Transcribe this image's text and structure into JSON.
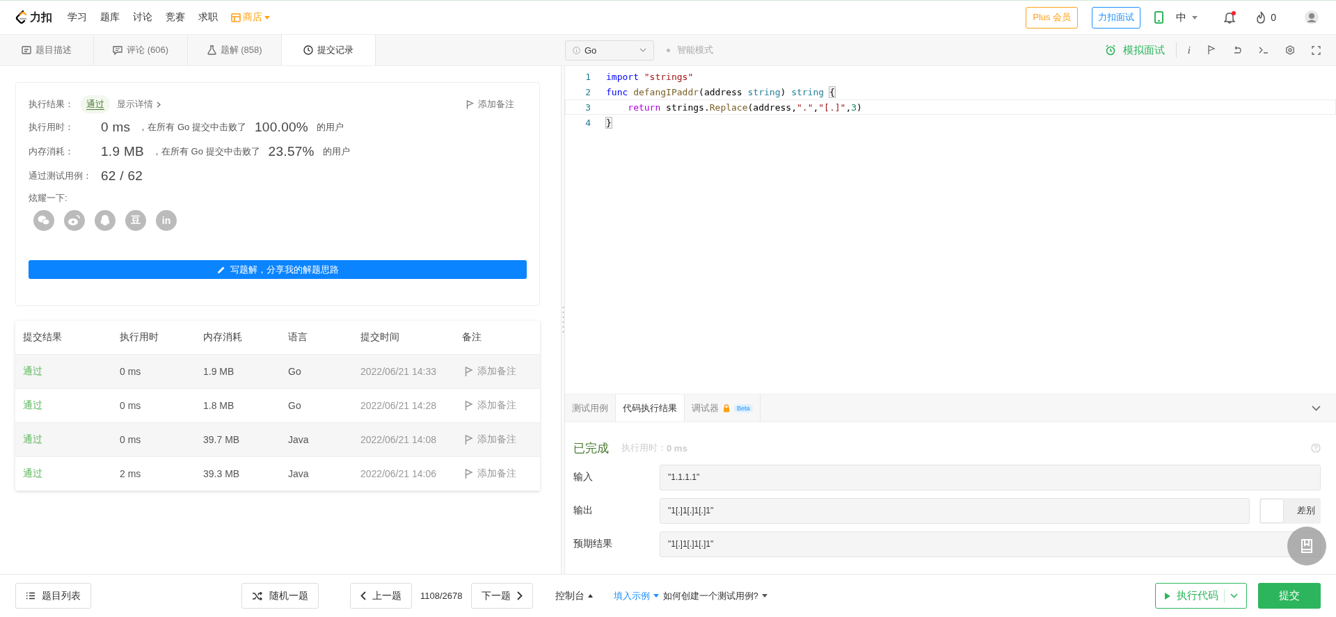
{
  "nav": {
    "logo": "力扣",
    "links": [
      {
        "label": "学习"
      },
      {
        "label": "题库"
      },
      {
        "label": "讨论"
      },
      {
        "label": "竞赛"
      },
      {
        "label": "求职"
      }
    ],
    "store": "商店",
    "plus": "Plus 会员",
    "interview": "力扣面试",
    "lang": "中",
    "unread": true,
    "fire_count": "0"
  },
  "left_tabs": [
    {
      "label": "题目描述",
      "selected": false
    },
    {
      "label": "评论 (606)",
      "selected": false
    },
    {
      "label": "题解 (858)",
      "selected": false
    },
    {
      "label": "提交记录",
      "selected": true
    }
  ],
  "result": {
    "result_label": "执行结果：",
    "status": "通过",
    "details": "显示详情",
    "add_note": "添加备注",
    "stats": [
      {
        "label": "执行用时：",
        "value": "0 ms",
        "text": "，在所有 Go 提交中击败了",
        "percent": "100.00%",
        "suffix": "的用户"
      },
      {
        "label": "内存消耗：",
        "value": "1.9 MB",
        "text": "，在所有 Go 提交中击败了",
        "percent": "23.57%",
        "suffix": "的用户"
      }
    ],
    "cases_label": "通过测试用例：",
    "cases": "62 / 62",
    "share_label": "炫耀一下:",
    "share": [
      {
        "kind": "wechat"
      },
      {
        "kind": "weibo"
      },
      {
        "kind": "qq"
      },
      {
        "kind": "glyph",
        "glyph": "豆"
      },
      {
        "kind": "glyph",
        "glyph": "in"
      }
    ],
    "write_button": "写题解，分享我的解题思路"
  },
  "table": {
    "columns": [
      "提交结果",
      "执行用时",
      "内存消耗",
      "语言",
      "提交时间",
      "备注"
    ],
    "rows": [
      {
        "status": "通过",
        "time": "0 ms",
        "memory": "1.9 MB",
        "language": "Go",
        "submitted": "2022/06/21 14:33",
        "note": "添加备注"
      },
      {
        "status": "通过",
        "time": "0 ms",
        "memory": "1.8 MB",
        "language": "Go",
        "submitted": "2022/06/21 14:28",
        "note": "添加备注"
      },
      {
        "status": "通过",
        "time": "0 ms",
        "memory": "39.7 MB",
        "language": "Java",
        "submitted": "2022/06/21 14:08",
        "note": "添加备注"
      },
      {
        "status": "通过",
        "time": "2 ms",
        "memory": "39.3 MB",
        "language": "Java",
        "submitted": "2022/06/21 14:06",
        "note": "添加备注"
      }
    ]
  },
  "editor_toolbar": {
    "language": "Go",
    "mode": "智能模式",
    "mock": "模拟面试",
    "info": "i"
  },
  "code": [
    {
      "number": "1",
      "tokens": [
        {
          "kind": "keyword",
          "text": "import"
        },
        {
          "kind": "string",
          "text": " \"strings\""
        }
      ]
    },
    {
      "number": "2",
      "tokens": [
        {
          "kind": "keyword",
          "text": "func"
        },
        {
          "kind": "function",
          "text": " defangIPaddr"
        },
        {
          "kind": "plain",
          "text": "(address "
        },
        {
          "kind": "type",
          "text": "string"
        },
        {
          "kind": "plain",
          "text": ") "
        },
        {
          "kind": "type",
          "text": "string "
        },
        {
          "kind": "bracket",
          "text": "{"
        }
      ]
    },
    {
      "number": "3",
      "current": true,
      "tokens": [
        {
          "kind": "control",
          "text": "    return"
        },
        {
          "kind": "plain",
          "text": " strings."
        },
        {
          "kind": "function",
          "text": "Replace"
        },
        {
          "kind": "plain",
          "text": "(address,"
        },
        {
          "kind": "string",
          "text": "\".\""
        },
        {
          "kind": "plain",
          "text": ","
        },
        {
          "kind": "string",
          "text": "\"[.]\""
        },
        {
          "kind": "plain",
          "text": ","
        },
        {
          "kind": "number",
          "text": "3"
        },
        {
          "kind": "plain",
          "text": ")"
        }
      ]
    },
    {
      "number": "4",
      "tokens": [
        {
          "kind": "bracket",
          "text": "}"
        }
      ]
    }
  ],
  "console_tabs": [
    {
      "label": "测试用例",
      "selected": false
    },
    {
      "label": "代码执行结果",
      "selected": true
    },
    {
      "label": "调试器",
      "locked": true,
      "badge": "Beta",
      "selected": false
    }
  ],
  "run_result": {
    "status": "已完成",
    "time_label": "执行用时：",
    "time": "0 ms",
    "fields": [
      {
        "label": "输入",
        "value": "\"1.1.1.1\""
      },
      {
        "label": "输出",
        "value": "\"1[.]1[.]1[.]1\"",
        "toggle": {
          "label": "差别",
          "on": false
        }
      },
      {
        "label": "预期结果",
        "value": "\"1[.]1[.]1[.]1\""
      }
    ]
  },
  "bottom_bar": {
    "list": "题目列表",
    "random": "随机一题",
    "prev": "上一题",
    "position": "1108/2678",
    "next": "下一题",
    "console": "控制台",
    "fill_example": "填入示例",
    "how_to": "如何创建一个测试用例?",
    "run": "执行代码",
    "submit": "提交"
  }
}
